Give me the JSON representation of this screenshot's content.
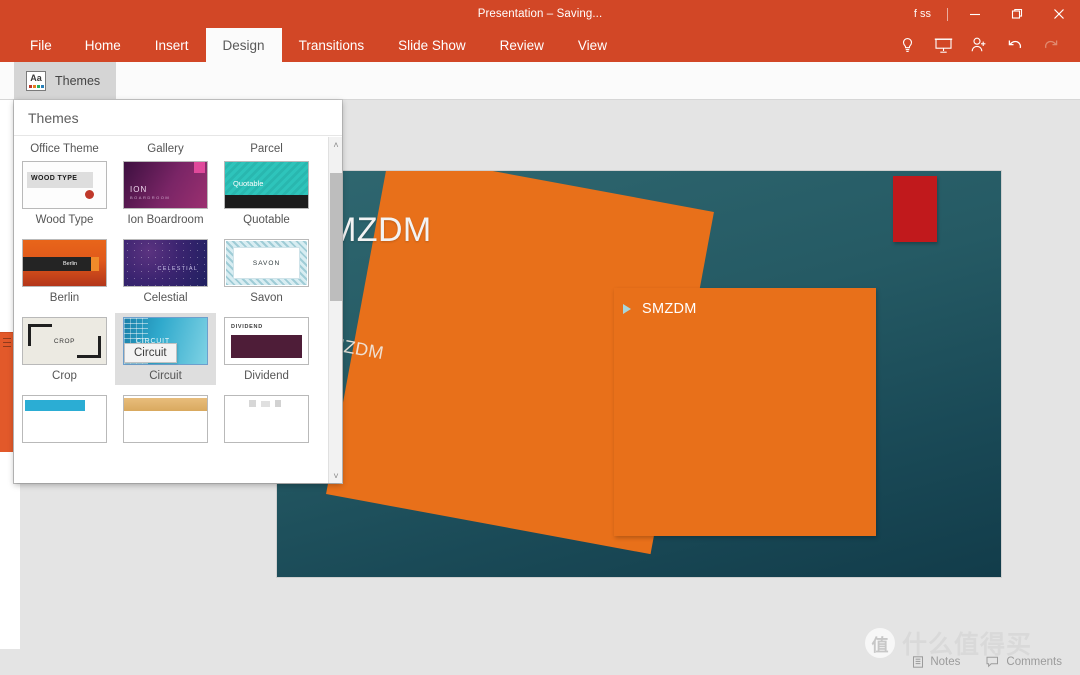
{
  "titlebar": {
    "title": "Presentation – Saving...",
    "user": "f ss",
    "minimize_label": "Minimize",
    "restore_label": "Restore Down",
    "close_label": "Close"
  },
  "ribbon": {
    "tabs": [
      {
        "label": "File",
        "active": false
      },
      {
        "label": "Home",
        "active": false
      },
      {
        "label": "Insert",
        "active": false
      },
      {
        "label": "Design",
        "active": true
      },
      {
        "label": "Transitions",
        "active": false
      },
      {
        "label": "Slide Show",
        "active": false
      },
      {
        "label": "Review",
        "active": false
      },
      {
        "label": "View",
        "active": false
      }
    ],
    "tools": [
      {
        "name": "tell-me-lightbulb-icon",
        "title": "Tell me what you want to do"
      },
      {
        "name": "present-online-icon",
        "title": "Present"
      },
      {
        "name": "share-person-icon",
        "title": "Share"
      },
      {
        "name": "undo-icon",
        "title": "Undo"
      },
      {
        "name": "redo-icon",
        "title": "Redo"
      }
    ],
    "themes_button": {
      "label": "Themes",
      "icon": "aa-themes-icon",
      "icon_text": "Aa"
    }
  },
  "themes_dropdown": {
    "header": "Themes",
    "column_labels": [
      "Office Theme",
      "Gallery",
      "Parcel"
    ],
    "tooltip": "Circuit",
    "scroll_up": "˄",
    "scroll_down": "˅",
    "rows": [
      [
        {
          "name": "Wood Type",
          "art": "th-wood",
          "selected": false,
          "thumb_text": "WOOD TYPE"
        },
        {
          "name": "Ion Boardroom",
          "art": "th-ion",
          "selected": false,
          "thumb_text": "ION",
          "thumb_sub": "BOARDROOM"
        },
        {
          "name": "Quotable",
          "art": "th-quot",
          "selected": false,
          "thumb_text": "Quotable"
        }
      ],
      [
        {
          "name": "Berlin",
          "art": "th-berlin",
          "selected": false,
          "thumb_text": "Berlin"
        },
        {
          "name": "Celestial",
          "art": "th-cel",
          "selected": false,
          "thumb_text": "CELESTIAL"
        },
        {
          "name": "Savon",
          "art": "th-savon",
          "selected": false,
          "thumb_text": "SAVON"
        }
      ],
      [
        {
          "name": "Crop",
          "art": "th-crop",
          "selected": false,
          "thumb_text": "CROP"
        },
        {
          "name": "Circuit",
          "art": "th-circ",
          "selected": true,
          "thumb_text": "CIRCUIT"
        },
        {
          "name": "Dividend",
          "art": "th-div",
          "selected": false,
          "thumb_text": "DIVIDEND"
        }
      ],
      [
        {
          "name": "",
          "art": "th-r4a",
          "selected": false,
          "thumb_text": ""
        },
        {
          "name": "",
          "art": "th-r4b",
          "selected": false,
          "thumb_text": ""
        },
        {
          "name": "",
          "art": "th-r4c",
          "selected": false,
          "thumb_text": ""
        }
      ]
    ]
  },
  "slide": {
    "title": "SMZDM",
    "rotated_text": "SMZDM",
    "content_bullet": "SMZDM",
    "colors": {
      "background_top": "#2f6770",
      "background_bottom": "#123c4a",
      "orange_shape": "#e8701a",
      "red_shape": "#c1191c",
      "bullet_marker": "#a8d6dc"
    }
  },
  "statusbar": {
    "notes_label": "Notes",
    "comments_label": "Comments",
    "notes_icon": "notes-icon",
    "comments_icon": "comment-bubble-icon"
  },
  "watermark": {
    "badge": "值",
    "text": "什么值得买"
  },
  "theme_colors": {
    "ribbon": "#d24726",
    "active_tab_bg": "#fbfbfb",
    "workspace": "#e4e4e4"
  }
}
